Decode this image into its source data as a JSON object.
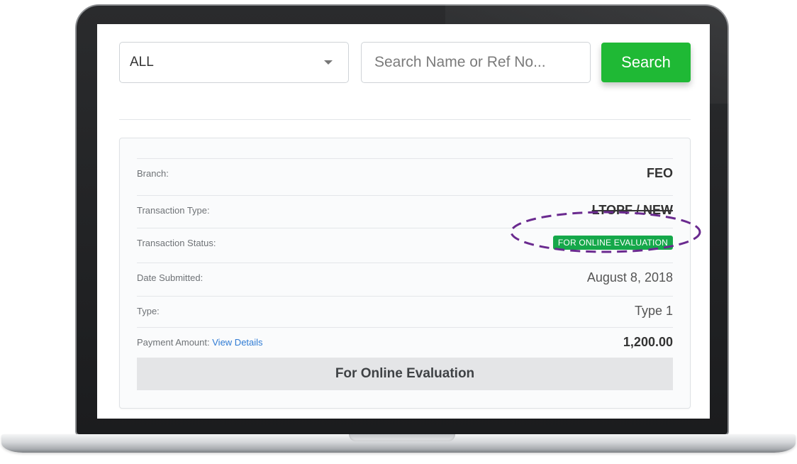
{
  "filter": {
    "selected": "ALL"
  },
  "search": {
    "placeholder": "Search Name or Ref No...",
    "value": "",
    "button_label": "Search"
  },
  "details": {
    "branch": {
      "label": "Branch:",
      "value": "FEO"
    },
    "transaction_type": {
      "label": "Transaction Type:",
      "value": "LTOPF / NEW"
    },
    "transaction_status": {
      "label": "Transaction Status:",
      "value": "FOR ONLINE EVALUATION"
    },
    "date_submitted": {
      "label": "Date Submitted:",
      "value": "August 8, 2018"
    },
    "type": {
      "label": "Type:",
      "value": "Type 1"
    },
    "payment_amount": {
      "label": "Payment Amount:",
      "link_text": "View Details",
      "value": "1,200.00"
    }
  },
  "footer_status": "For Online Evaluation",
  "colors": {
    "accent_green": "#1fb935",
    "status_badge_green": "#15a84a",
    "link_blue": "#2f7bd4",
    "highlight_purple": "#6a2a8f"
  }
}
